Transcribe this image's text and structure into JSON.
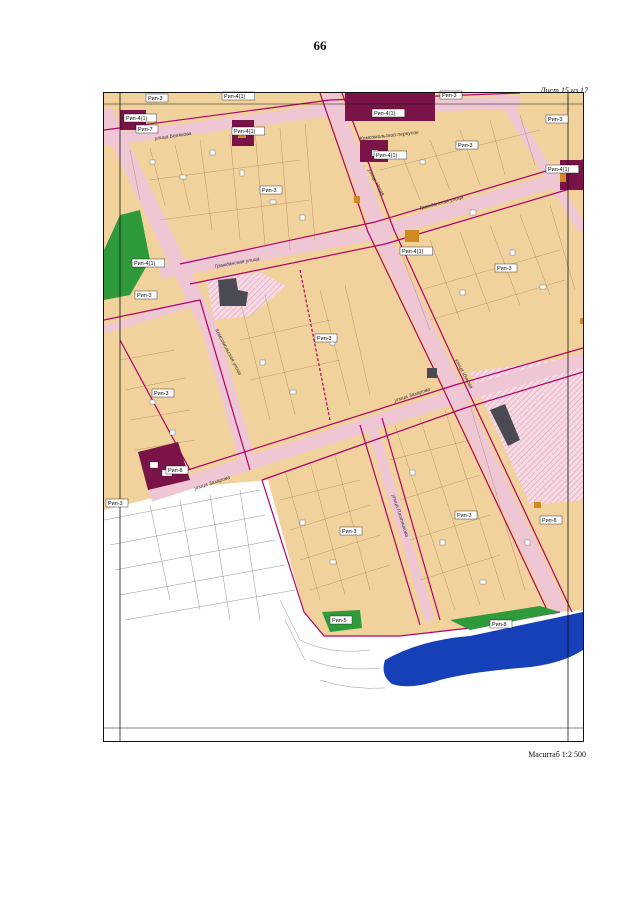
{
  "page": {
    "number": "66",
    "sheet": "Лист 15 из 17",
    "scale": "Масштаб 1:2 500"
  },
  "colors": {
    "residential_zone": "#f1d29c",
    "street_pink": "#efc6d3",
    "boundary_magenta": "#b0006a",
    "public_zone": "#7a1448",
    "green_zone": "#2f9a3c",
    "water": "#1640b8",
    "building_dark": "#4a4a55",
    "building_orange": "#d08a22",
    "hatched_zone": "#f6d9e3"
  },
  "zones": [
    {
      "code": "Рип-3"
    },
    {
      "code": "Рип-4(1)"
    },
    {
      "code": "Рип-4(1)"
    },
    {
      "code": "Рип-7"
    },
    {
      "code": "Рип-4(1)"
    },
    {
      "code": "Рип-4(1)"
    },
    {
      "code": "Рип-3"
    },
    {
      "code": "Рип-4(1)"
    },
    {
      "code": "Рип-3"
    },
    {
      "code": "Рип-4(1)"
    },
    {
      "code": "Рип-4(1)"
    },
    {
      "code": "Рип-3"
    },
    {
      "code": "Рип-4(1)"
    },
    {
      "code": "Рип-3"
    },
    {
      "code": "Рип-3"
    },
    {
      "code": "Рип-3"
    },
    {
      "code": "Рип-8"
    },
    {
      "code": "Рип-3"
    },
    {
      "code": "Рип-3"
    },
    {
      "code": "Рип-3"
    },
    {
      "code": "Рип-3"
    },
    {
      "code": "Рип-8"
    },
    {
      "code": "Рип-3"
    },
    {
      "code": "Рип-8"
    },
    {
      "code": "Рип-5"
    }
  ],
  "streets": [
    {
      "name": "улица Белякова"
    },
    {
      "name": "Комсомольский переулок"
    },
    {
      "name": "Гражданская улица"
    },
    {
      "name": "Гражданская улица"
    },
    {
      "name": "улица Новая"
    },
    {
      "name": "улица Шукова"
    },
    {
      "name": "улица Плотникова"
    },
    {
      "name": "улица Захарова"
    },
    {
      "name": "улица Захарова"
    },
    {
      "name": "Комсомольская улица"
    }
  ]
}
